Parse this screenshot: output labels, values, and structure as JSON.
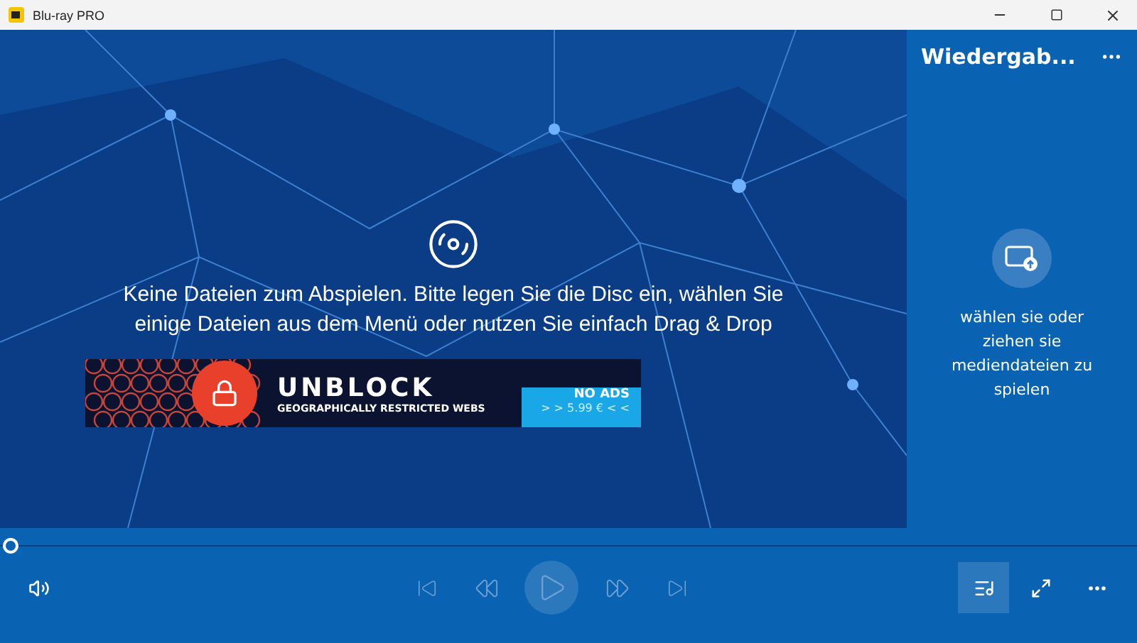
{
  "window": {
    "title": "Blu-ray PRO"
  },
  "player": {
    "message": "Keine Dateien zum Abspielen. Bitte legen Sie die Disc ein, wählen Sie einige Dateien aus dem Menü oder nutzen Sie einfach Drag & Drop"
  },
  "ad": {
    "title": "UNBLOCK",
    "subtitle": "GEOGRAPHICALLY RESTRICTED WEBS",
    "badge": "NO ADS",
    "price": "> > 5.99 € < <"
  },
  "sidebar": {
    "title": "Wiedergab...",
    "hint": "wählen sie oder ziehen sie mediendateien zu spielen"
  },
  "seek": {
    "level": 0
  },
  "controls": {
    "playback_disabled": true,
    "playlist_selected": true
  }
}
